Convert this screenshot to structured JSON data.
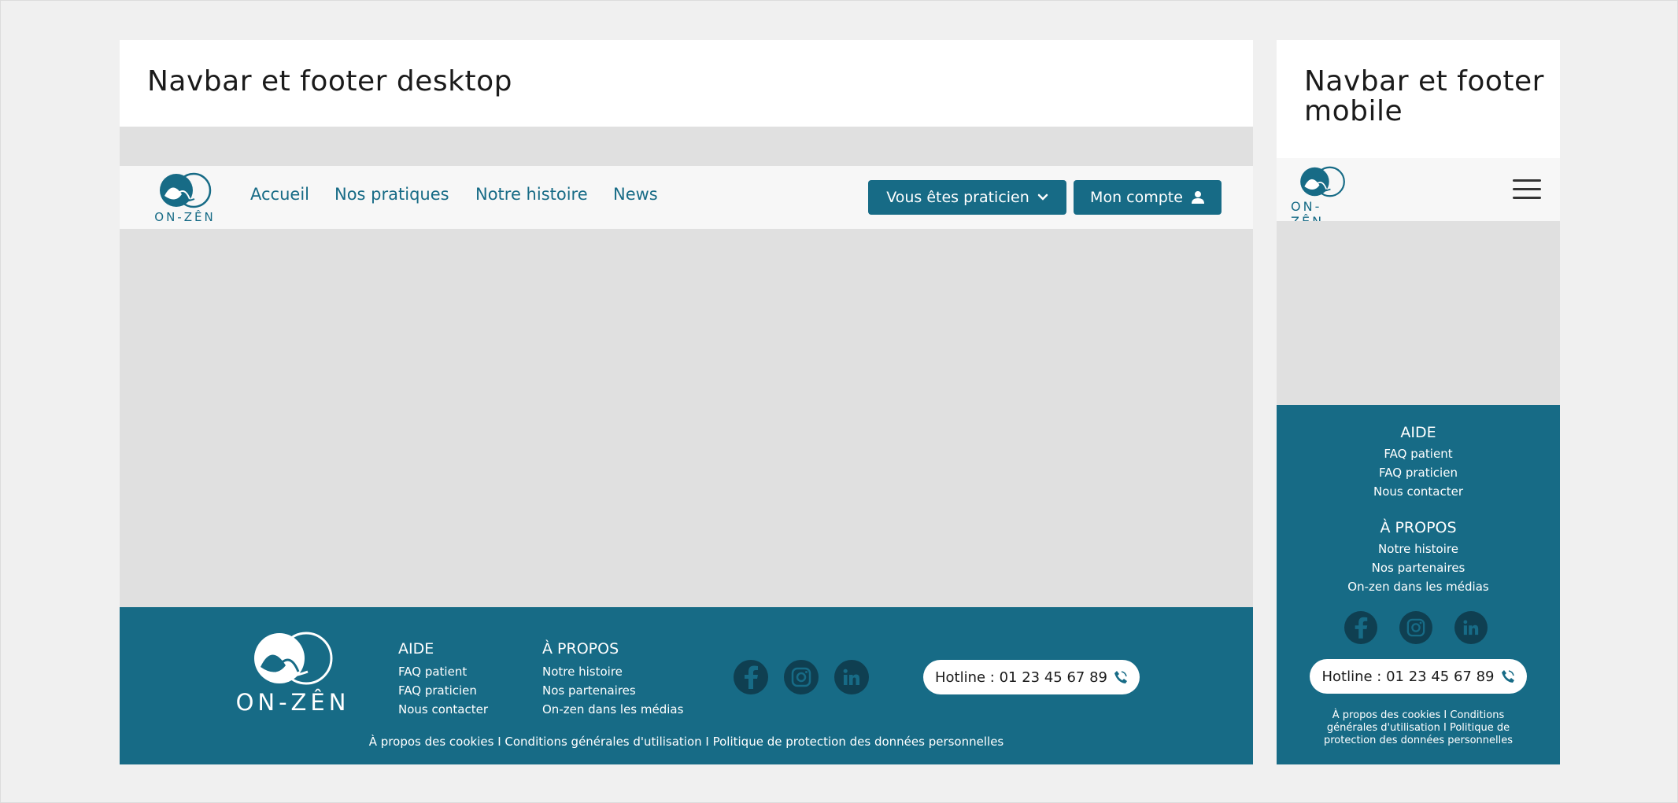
{
  "desktop": {
    "title": "Navbar et footer desktop",
    "nav": {
      "logo_text": "ON-ZÊN",
      "links": [
        "Accueil",
        "Nos pratiques",
        "Notre histoire",
        "News"
      ],
      "btn_praticien": "Vous êtes praticien",
      "btn_compte": "Mon compte"
    },
    "footer": {
      "logo_text": "ON-ZÊN",
      "aide": {
        "title": "AIDE",
        "links": [
          "FAQ patient",
          "FAQ praticien",
          "Nous contacter"
        ]
      },
      "apropos": {
        "title": "À PROPOS",
        "links": [
          "Notre histoire",
          "Nos partenaires",
          "On-zen dans les médias"
        ]
      },
      "socials": [
        "facebook-icon",
        "instagram-icon",
        "linkedin-icon"
      ],
      "hotline": "Hotline : 01 23 45 67 89",
      "legal": "À propos des cookies I Conditions générales d'utilisation I Politique de protection des données personnelles"
    }
  },
  "mobile": {
    "title": "Navbar et footer mobile",
    "nav": {
      "logo_text": "ON-ZÊN"
    },
    "footer": {
      "aide": {
        "title": "AIDE",
        "links": [
          "FAQ patient",
          "FAQ praticien",
          "Nous contacter"
        ]
      },
      "apropos": {
        "title": "À PROPOS",
        "links": [
          "Notre histoire",
          "Nos partenaires",
          "On-zen dans les médias"
        ]
      },
      "hotline": "Hotline : 01 23 45 67 89",
      "legal": "À propos des cookies I Conditions générales d'utilisation I Politique de protection des données personnelles"
    }
  },
  "colors": {
    "brand": "#176b86",
    "social_bg": "#0f3f51",
    "placeholder": "#e0e0e0",
    "nav_bg": "#f7f7f7"
  }
}
